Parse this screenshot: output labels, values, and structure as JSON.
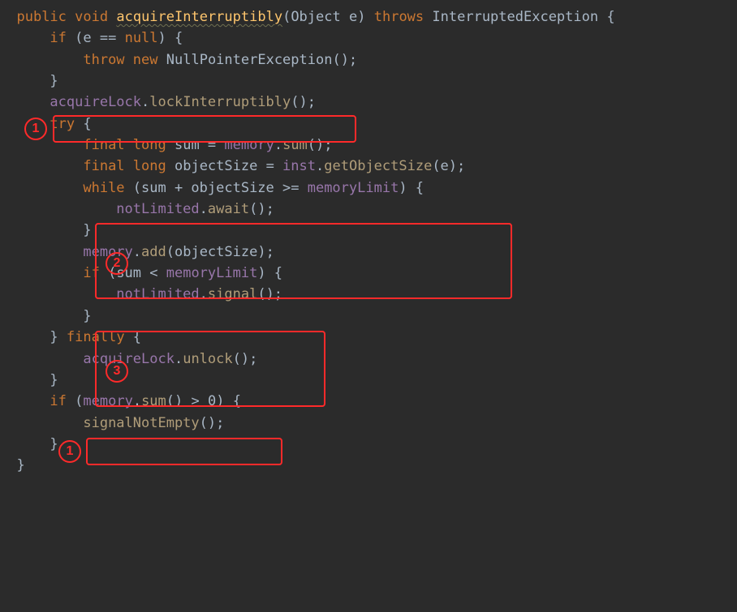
{
  "annotations": {
    "marker1": "1",
    "marker2": "2",
    "marker3": "3"
  },
  "code": {
    "sig": {
      "public": "public",
      "void": "void",
      "name": "acquireInterruptibly",
      "lparen": "(",
      "ptype": "Object",
      "pname": "e",
      "rparen": ")",
      "throws": "throws",
      "exc": "InterruptedException",
      "lbrace": "{"
    },
    "l2": {
      "if": "if",
      "cond": "(e == ",
      "null": "null",
      "close": ") {"
    },
    "l3": {
      "throw": "throw",
      "new": "new",
      "npe": "NullPointerException();"
    },
    "l4": {
      "rbrace": "}"
    },
    "l5": {
      "lock": "acquireLock",
      "dot": ".",
      "call": "lockInterruptibly",
      "end": "();"
    },
    "l6": {
      "try": "try",
      "lbrace": " {"
    },
    "l7": {
      "final": "final",
      "long": "long",
      "var": " sum = ",
      "mem": "memory",
      "dot": ".",
      "call": "sum",
      "end": "();"
    },
    "l8": {
      "final": "final",
      "long": "long",
      "var": " objectSize = ",
      "inst": "inst",
      "dot": ".",
      "call": "getObjectSize",
      "end": "(e);"
    },
    "l9": {
      "while": "while",
      "open": " (sum + objectSize >= ",
      "lim": "memoryLimit",
      "close": ") {"
    },
    "l10": {
      "nl": "notLimited",
      "dot": ".",
      "call": "await",
      "end": "();"
    },
    "l11": {
      "rbrace": "}"
    },
    "l12": {
      "mem": "memory",
      "dot": ".",
      "call": "add",
      "end": "(objectSize);"
    },
    "l13": {
      "if": "if",
      "open": " (sum < ",
      "lim": "memoryLimit",
      "close": ") {"
    },
    "l14": {
      "nl": "notLimited",
      "dot": ".",
      "call": "signal",
      "end": "();"
    },
    "l15": {
      "rbrace": "}"
    },
    "l16": {
      "close": "} ",
      "finally": "finally",
      "lbrace": " {"
    },
    "l17": {
      "lock": "acquireLock",
      "dot": ".",
      "call": "unlock",
      "end": "();"
    },
    "l18": {
      "rbrace": "}"
    },
    "l19": {
      "if": "if",
      "open": " (",
      "mem": "memory",
      "dot": ".",
      "call": "sum",
      "mid": "() > ",
      "zero": "0",
      "close": ") {"
    },
    "l20": {
      "call": "signalNotEmpty",
      "end": "();"
    },
    "l21": {
      "rbrace": "}"
    },
    "l22": {
      "rbrace": "}"
    }
  }
}
